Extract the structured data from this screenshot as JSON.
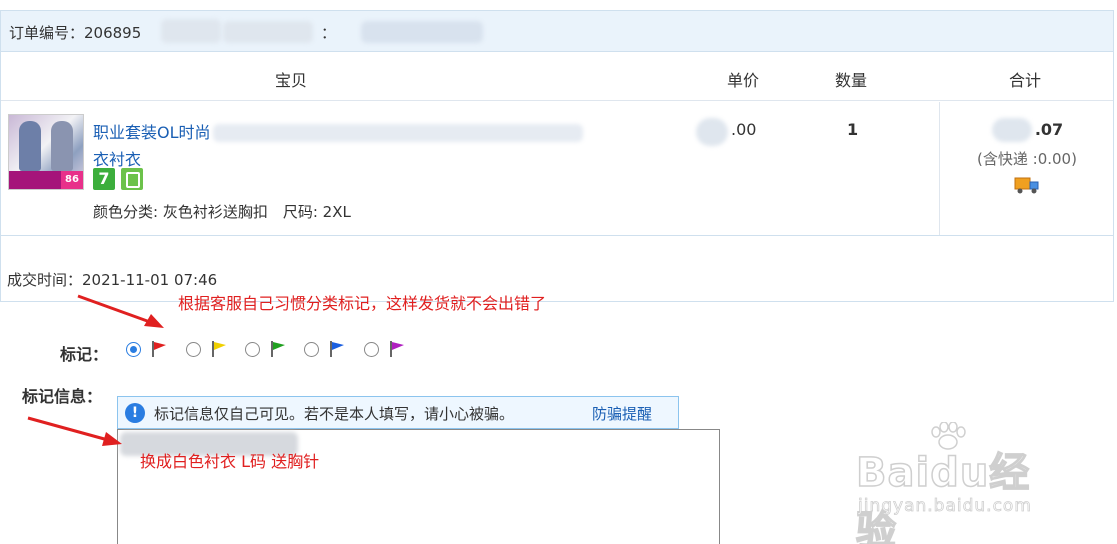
{
  "order": {
    "number_label": "订单编号：206895",
    "number_suffix": "：",
    "deal_time": "成交时间：2021-11-01 07:46"
  },
  "columns": {
    "item": "宝贝",
    "price": "单价",
    "quantity": "数量",
    "total": "合计"
  },
  "item": {
    "title_line1": "职业套装OL时尚",
    "title_line2": "衣衬衣",
    "thumb_tag": "86",
    "badge_seven": "7",
    "attributes": "颜色分类: 灰色衬衫送胸扣　尺码: 2XL",
    "unit_price": ".00",
    "quantity": "1",
    "total": ".07",
    "shipping_fee": "(含快递 :0.00)"
  },
  "annotations": {
    "top": "根据客服自己习惯分类标记，这样发货就不会出错了",
    "bottom": "换成白色衬衣  L码  送胸针"
  },
  "mark": {
    "label": "标记：",
    "selected_index": 0,
    "flags": [
      {
        "color": "#e02020",
        "name": "red-flag-icon"
      },
      {
        "color": "#f0d000",
        "name": "yellow-flag-icon"
      },
      {
        "color": "#20a020",
        "name": "green-flag-icon"
      },
      {
        "color": "#1a5fe0",
        "name": "blue-flag-icon"
      },
      {
        "color": "#b020c0",
        "name": "purple-flag-icon"
      }
    ]
  },
  "mark_info": {
    "label": "标记信息：",
    "tip_text": "标记信息仅自己可见。若不是本人填写，请小心被骗。",
    "tip_link": "防骗提醒",
    "info_icon": "!"
  },
  "watermark": {
    "brand": "Baidu经验",
    "url": "jingyan.baidu.com"
  }
}
